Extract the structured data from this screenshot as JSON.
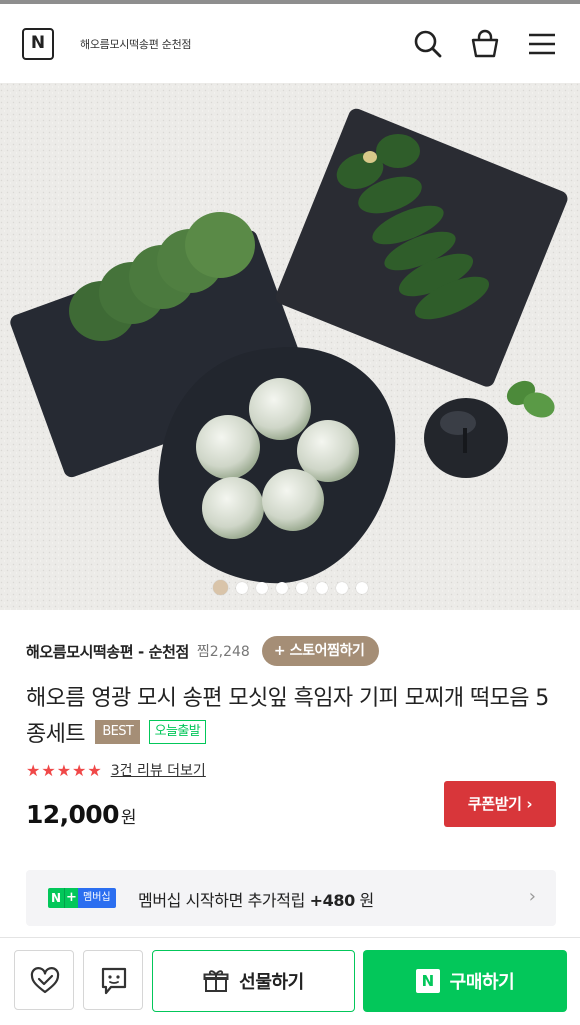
{
  "header": {
    "logo_letter": "N",
    "store_name": "해오름모시떡송편 순천점",
    "icons": [
      "search-icon",
      "cart-icon",
      "menu-icon"
    ]
  },
  "gallery": {
    "image_label": "모시떡 5종세트 상품 이미지",
    "page_count": 8,
    "active_index": 0
  },
  "store": {
    "name": "해오름모시떡송편 - 순천점",
    "zzim_count": "찜2,248",
    "zzim_button": "+ 스토어찜하기"
  },
  "product": {
    "title": "해오름 영광 모시 송편 모싯잎 흑임자 기피 모찌개 떡모음 5종세트",
    "badge_best": "BEST",
    "badge_today": "오늘출발",
    "stars": "★★★★★",
    "rating": 5,
    "review_link": "3건 리뷰 더보기",
    "price": "12,000",
    "price_unit": "원",
    "coupon_label": "쿠폰받기 ›"
  },
  "membership": {
    "badge_n": "N",
    "badge_plus": "+",
    "badge_text": "멤버십",
    "text_prefix": "멤버십 시작하면 추가적립",
    "reward": "+480",
    "reward_unit": "원",
    "chevron": "›"
  },
  "bottom_bar": {
    "gift_label": "선물하기",
    "buy_label": "구매하기",
    "buy_logo": "N"
  },
  "colors": {
    "naver_green": "#03c75a",
    "coupon_red": "#d8363a",
    "brown_badge": "#a58e76",
    "star_red": "#f04848"
  }
}
